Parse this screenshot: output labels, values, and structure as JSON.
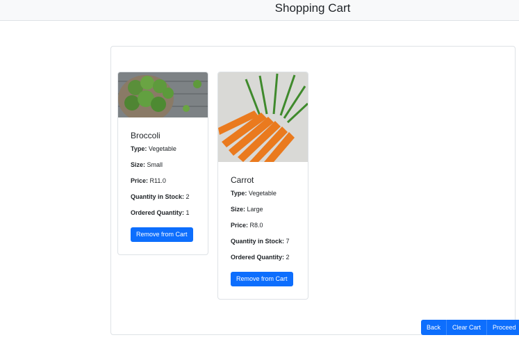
{
  "header": {
    "title": "Shopping Cart"
  },
  "cart": {
    "items": [
      {
        "name": "Broccoli",
        "image": "broccoli-photo",
        "type_label": "Type:",
        "type": "Vegetable",
        "size_label": "Size:",
        "size": "Small",
        "price_label": "Price:",
        "price": "R11.0",
        "stock_label": "Quantity in Stock:",
        "stock": "2",
        "ordered_label": "Ordered Quantity:",
        "ordered": "1",
        "remove_label": "Remove from Cart"
      },
      {
        "name": "Carrot",
        "image": "carrot-photo",
        "type_label": "Type:",
        "type": "Vegetable",
        "size_label": "Size:",
        "size": "Large",
        "price_label": "Price:",
        "price": "R8.0",
        "stock_label": "Quantity in Stock:",
        "stock": "7",
        "ordered_label": "Ordered Quantity:",
        "ordered": "2",
        "remove_label": "Remove from Cart"
      }
    ]
  },
  "actions": {
    "back": "Back",
    "clear": "Clear Cart",
    "proceed": "Proceed"
  },
  "colors": {
    "primary": "#0d6efd",
    "header_bg": "#f8f9fa",
    "border": "#dee2e6"
  }
}
